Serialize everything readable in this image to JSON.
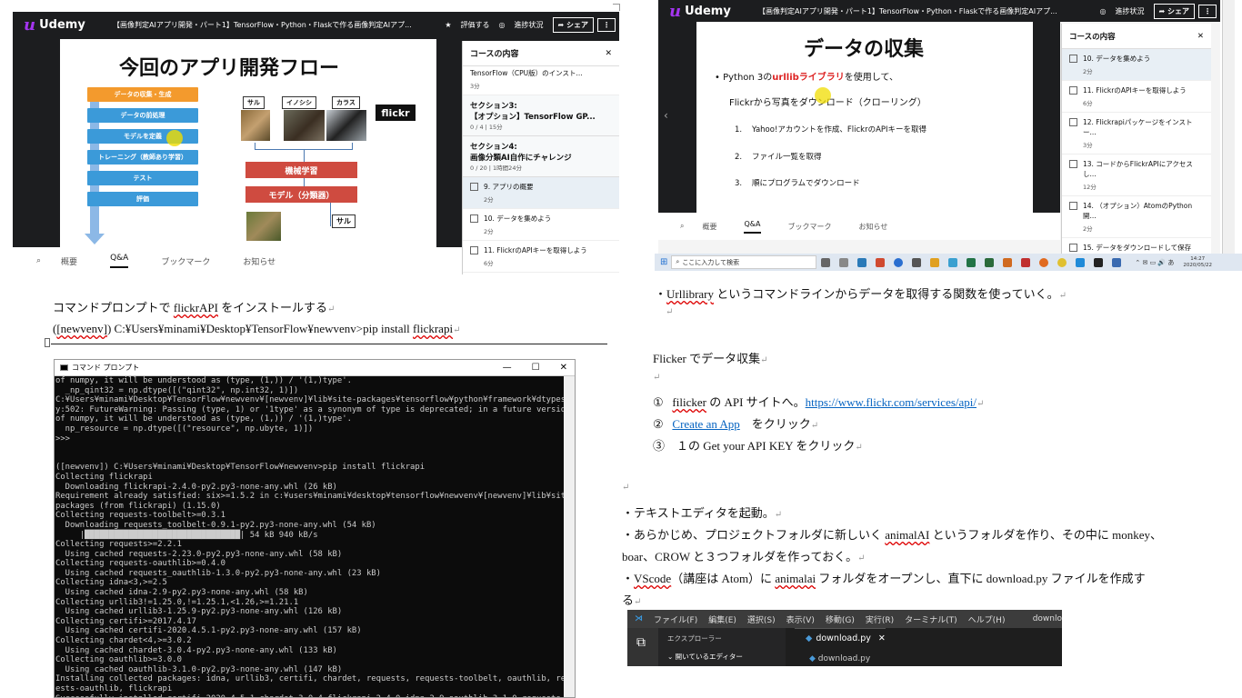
{
  "udemy_left": {
    "logo": "Udemy",
    "course_title": "【画像判定AIアプリ開発・パート1】TensorFlow・Python・Flaskで作る画像判定AIアプ...",
    "rate_label": "評価する",
    "progress_label": "進捗状況",
    "share_label": "シェア",
    "slide_title": "今回のアプリ開発フロー",
    "flow_steps": [
      "データの収集・生成",
      "データの前処理",
      "モデルを定義",
      "トレーニング（教師あり学習）",
      "テスト",
      "評価"
    ],
    "animal_labels": [
      "サル",
      "イノシシ",
      "カラス"
    ],
    "flickr_label": "flickr",
    "ml_box": "機械学習",
    "model_box": "モデル（分類器）",
    "result_label": "サル",
    "sidebar_title": "コースの内容",
    "sidebar_top_item": "TensorFlow（CPU版）のインスト...",
    "sidebar_top_item_time": "3分",
    "section3_title": "セクション3:",
    "section3_sub": "【オプション】TensorFlow GP...",
    "section3_meta": "0 / 4 | 15分",
    "section4_title": "セクション4:",
    "section4_sub": "画像分類AI自作にチャレンジ",
    "section4_meta": "0 / 20 | 1時間24分",
    "items": [
      {
        "label": "9. アプリの概要",
        "time": "2分"
      },
      {
        "label": "10. データを集めよう",
        "time": "2分"
      },
      {
        "label": "11. FlickrのAPIキーを取得しよう",
        "time": "6分"
      }
    ],
    "tabs": [
      "概要",
      "Q&A",
      "ブックマーク",
      "お知らせ"
    ]
  },
  "udemy_right": {
    "logo": "Udemy",
    "course_title": "【画像判定AIアプリ開発・パート1】TensorFlow・Python・Flaskで作る画像判定AIアプ...",
    "progress_label": "進捗状況",
    "share_label": "シェア",
    "slide_title": "データの収集",
    "bullet_prefix": "Python 3の",
    "bullet_highlight": "urllibライブラリ",
    "bullet_suffix": "を使用して、",
    "bullet_line2": "Flickrから写真をダウンロード（クローリング）",
    "steps": [
      "Yahoo!アカウントを作成、FlickrのAPIキーを取得",
      "ファイル一覧を取得",
      "順にプログラムでダウンロード"
    ],
    "step_nums": [
      "1.",
      "2.",
      "3."
    ],
    "sidebar_title": "コースの内容",
    "items": [
      {
        "label": "10. データを集めよう",
        "time": "2分"
      },
      {
        "label": "11. FlickrのAPIキーを取得しよう",
        "time": "6分"
      },
      {
        "label": "12. Flickrapiパッケージをインストー...",
        "time": "3分"
      },
      {
        "label": "13. コードからFlickrAPIにアクセスし...",
        "time": "12分"
      },
      {
        "label": "14. （オプション）AtomのPython開...",
        "time": "2分"
      },
      {
        "label": "15. データをダウンロードして保存し...",
        "time": ""
      }
    ],
    "tabs": [
      "概要",
      "Q&A",
      "ブックマーク",
      "お知らせ"
    ]
  },
  "taskbar": {
    "search_placeholder": "ここに入力して検索",
    "time": "14:27",
    "date": "2020/05/22"
  },
  "doc_left": {
    "line1_prefix": "コマンドプロンプトで ",
    "line1_link": "flickrAPI",
    "line1_suffix": " をインストールする",
    "line2_prefix": "(",
    "line2_env": "[newvenv]",
    "line2_suffix": ") C:¥Users¥minami¥Desktop¥TensorFlow¥newvenv>pip install ",
    "line2_pkg": "flickrapi"
  },
  "cmd": {
    "title": "コマンド プロンプト",
    "lines": [
      "of numpy, it will be understood as (type, (1,)) / '(1,)type'.",
      "  _np_qint32 = np.dtype([(\"qint32\", np.int32, 1)])",
      "C:¥Users¥minami¥Desktop¥TensorFlow¥newvenv¥[newvenv]¥lib¥site-packages¥tensorflow¥python¥framework¥dtypes.p",
      "y:502: FutureWarning: Passing (type, 1) or '1type' as a synonym of type is deprecated; in a future version",
      "of numpy, it will be understood as (type, (1,)) / '(1,)type'.",
      "  np_resource = np.dtype([(\"resource\", np.ubyte, 1)])",
      ">>>",
      "",
      "",
      "([newvenv]) C:¥Users¥minami¥Desktop¥TensorFlow¥newvenv>pip install flickrapi",
      "Collecting flickrapi",
      "  Downloading flickrapi-2.4.0-py2.py3-none-any.whl (26 kB)",
      "Requirement already satisfied: six>=1.5.2 in c:¥users¥minami¥desktop¥tensorflow¥newvenv¥[newvenv]¥lib¥site-",
      "packages (from flickrapi) (1.15.0)",
      "Collecting requests-toolbelt>=0.3.1",
      "  Downloading requests_toolbelt-0.9.1-py2.py3-none-any.whl (54 kB)",
      "     |████████████████████████████████| 54 kB 940 kB/s",
      "Collecting requests>=2.2.1",
      "  Using cached requests-2.23.0-py2.py3-none-any.whl (58 kB)",
      "Collecting requests-oauthlib>=0.4.0",
      "  Using cached requests_oauthlib-1.3.0-py2.py3-none-any.whl (23 kB)",
      "Collecting idna<3,>=2.5",
      "  Using cached idna-2.9-py2.py3-none-any.whl (58 kB)",
      "Collecting urllib3!=1.25.0,!=1.25.1,<1.26,>=1.21.1",
      "  Using cached urllib3-1.25.9-py2.py3-none-any.whl (126 kB)",
      "Collecting certifi>=2017.4.17",
      "  Using cached certifi-2020.4.5.1-py2.py3-none-any.whl (157 kB)",
      "Collecting chardet<4,>=3.0.2",
      "  Using cached chardet-3.0.4-py2.py3-none-any.whl (133 kB)",
      "Collecting oauthlib>=3.0.0",
      "  Using cached oauthlib-3.1.0-py2.py3-none-any.whl (147 kB)",
      "Installing collected packages: idna, urllib3, certifi, chardet, requests, requests-toolbelt, oauthlib, requ",
      "ests-oauthlib, flickrapi",
      "Successfully installed certifi-2020.4.5.1 chardet-3.0.4 flickrapi-2.4.0 idna-2.9 oauthlib-3.1.0 requests-2"
    ]
  },
  "doc_right": {
    "urllib_line_prefix": "・",
    "urllib_word": "Urllibrary",
    "urllib_line_suffix": " というコマンドラインからデータを取得する関数を使っていく。",
    "flicker_heading": "Flicker でデータ収集",
    "step1_num": "①",
    "step1_word": "filicker",
    "step1_text": " の API サイトへ。",
    "step1_link": "https://www.flickr.com/services/api/",
    "step2_num": "②",
    "step2_link": "Create an App",
    "step2_text": "　をクリック",
    "step3_num": "③",
    "step3_text": "　１の Get your API KEY をクリック",
    "bullet1": "・テキストエディタを起動。",
    "bullet2_a": "・あらかじめ、プロジェクトフォルダに新しいく ",
    "bullet2_word": "animalAI",
    "bullet2_b": " というフォルダを作り、その中に monkey、",
    "bullet2_line2": "boar、CROW と３つフォルダを作っておく。",
    "bullet3_a": "・",
    "bullet3_word": "VScode",
    "bullet3_b": "（講座は Atom）に ",
    "bullet3_word2": "animalai",
    "bullet3_c": " フォルダをオープンし、直下に download.py ファイルを作成す",
    "bullet3_line2": "る"
  },
  "vscode": {
    "menu": [
      "ファイル(F)",
      "編集(E)",
      "選択(S)",
      "表示(V)",
      "移動(G)",
      "実行(R)",
      "ターミナル(T)",
      "ヘルプ(H)"
    ],
    "title_cut": "downlo",
    "explorer_label": "エクスプローラー",
    "open_editors": "開いているエディター",
    "tab_name": "download.py",
    "open_file": "download.py"
  }
}
